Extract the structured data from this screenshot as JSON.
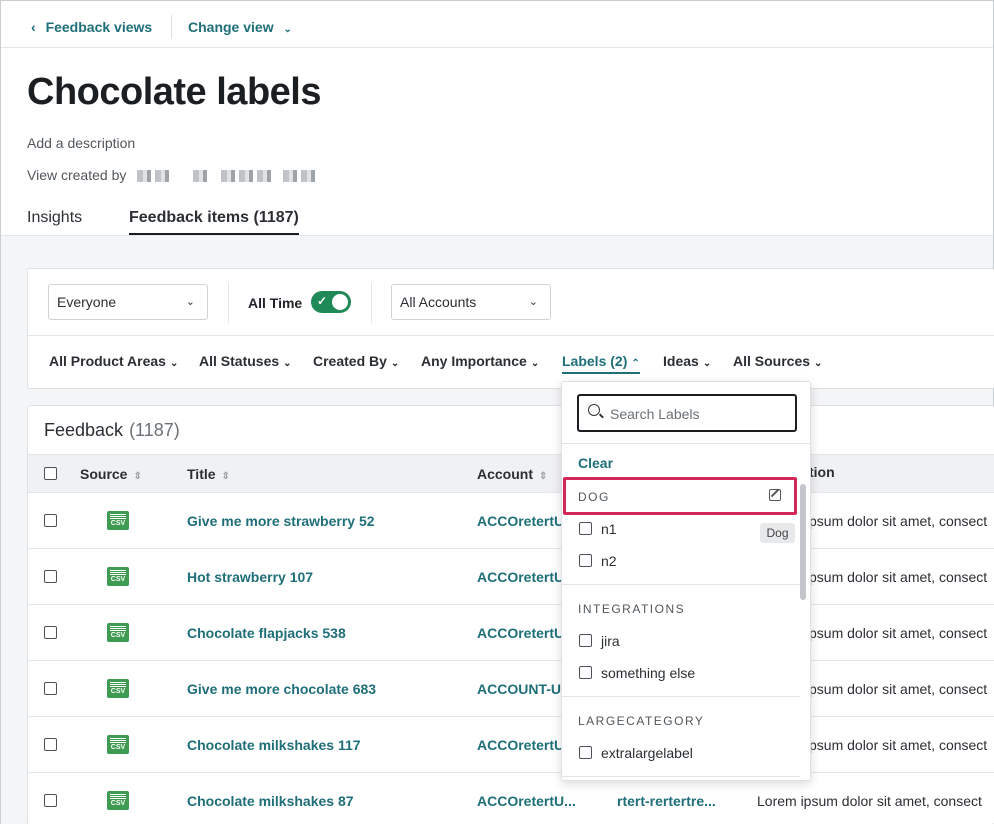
{
  "nav": {
    "back_label": "Feedback views",
    "change_view_label": "Change view"
  },
  "page": {
    "title": "Chocolate labels",
    "description_placeholder": "Add a description",
    "created_by_label": "View created by"
  },
  "tabs": [
    {
      "label": "Insights"
    },
    {
      "label": "Feedback items  (1187)"
    }
  ],
  "filters": {
    "people": "Everyone",
    "time_label": "All Time",
    "time_enabled": true,
    "accounts": "All Accounts",
    "chips": [
      "All Product Areas",
      "All Statuses",
      "Created By",
      "Any Importance",
      "Labels (2)",
      "Ideas",
      "All Sources"
    ]
  },
  "feedback": {
    "heading": "Feedback",
    "count": "(1187)",
    "columns": [
      "Source",
      "Title",
      "Account",
      "tion"
    ],
    "rows": [
      {
        "title": "Give me more strawberry 52",
        "account": "ACCOretertU",
        "desc": "psum dolor sit amet, consect"
      },
      {
        "title": "Hot strawberry 107",
        "account": "ACCOretertU",
        "desc": "psum dolor sit amet, consect"
      },
      {
        "title": "Chocolate flapjacks 538",
        "account": "ACCOretertU",
        "desc": "psum dolor sit amet, consect"
      },
      {
        "title": "Give me more chocolate 683",
        "account": "ACCOUNT-U",
        "desc": "psum dolor sit amet, consect"
      },
      {
        "title": "Chocolate milkshakes 117",
        "account": "ACCOretertU",
        "desc": "psum dolor sit amet, consect"
      },
      {
        "title": "Chocolate milkshakes 87",
        "account": "ACCOretertU...",
        "desc": "Lorem ipsum dolor sit amet, consect",
        "extra": "rtert-rertertre..."
      }
    ],
    "source_badge": "CSV"
  },
  "labels_dropdown": {
    "search_placeholder": "Search Labels",
    "clear_label": "Clear",
    "groups": [
      {
        "name": "DOG",
        "items": [
          "n1",
          "n2"
        ]
      },
      {
        "name": "INTEGRATIONS",
        "items": [
          "jira",
          "something else"
        ]
      },
      {
        "name": "LARGECATEGORY",
        "items": [
          "extralargelabel"
        ]
      }
    ],
    "tooltip": "Dog"
  },
  "colors": {
    "accent": "#1e6f7a",
    "toggle_on": "#1f8a57",
    "highlight": "#d4285a",
    "csv_badge": "#3f9a52"
  }
}
